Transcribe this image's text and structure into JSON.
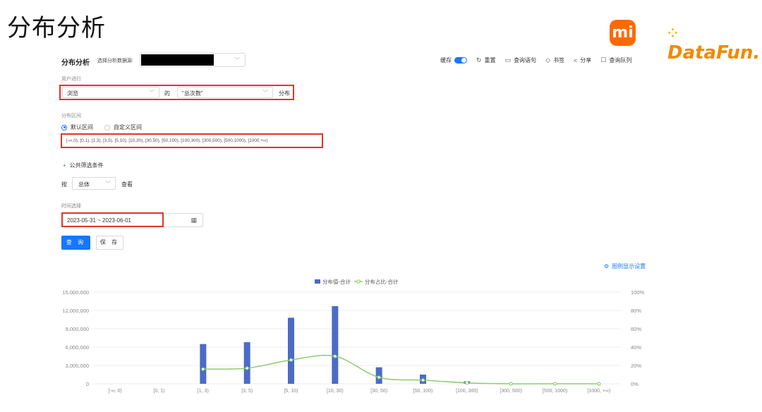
{
  "slide": {
    "title": "分布分析",
    "logo_mi": "mi",
    "logo_datafun": "DataFun."
  },
  "header": {
    "title": "分布分析",
    "datasource_label": "选择分析数据源:"
  },
  "toolbar": {
    "cache_label": "缓存",
    "reset_label": "重置",
    "query_sql_label": "查询语句",
    "bookmark_label": "书签",
    "share_label": "分享",
    "queue_label": "查询队列"
  },
  "behavior": {
    "section_label": "用户进行",
    "event_value": "浏览",
    "of_label": "的",
    "metric_value": "\"总次数\"",
    "dist_label": "分布"
  },
  "interval": {
    "section_label": "分布区间",
    "default_label": "默认区间",
    "custom_label": "自定义区间",
    "ranges_text": "[-∞,0), [0,1), [1,3), [3,5), [5,10), [10,30), [30,50), [50,100), [100,300), [300,500), [500,1000), [1000,+∞)"
  },
  "filter": {
    "add_label": "公共筛选条件"
  },
  "groupby": {
    "by_label": "按",
    "value": "总体",
    "view_label": "查看"
  },
  "time": {
    "section_label": "时间选择",
    "range_value": "2023-05-31 ~ 2023-06-01"
  },
  "buttons": {
    "query_label": "查 询",
    "save_label": "保 存"
  },
  "legend_settings_label": "图例显示设置",
  "colors": {
    "bar": "#4b6bc6",
    "line": "#8fcc6e",
    "accent": "#1677ff",
    "highlight": "#e0342b"
  },
  "chart_data": {
    "type": "bar",
    "categories": [
      "[-∞, 0)",
      "[0, 1)",
      "[1, 3)",
      "[3, 5)",
      "[5, 10)",
      "[10, 30)",
      "[30, 50)",
      "[50, 100)",
      "[100, 300)",
      "[300, 500)",
      "[500, 1000)",
      "[1000, +∞)"
    ],
    "y_ticks": [
      "0",
      "3,000,000",
      "6,000,000",
      "9,000,000",
      "12,000,000",
      "15,000,000"
    ],
    "y2_ticks": [
      "0%",
      "20%",
      "40%",
      "60%",
      "80%",
      "100%"
    ],
    "ylim": [
      0,
      15000000
    ],
    "y2lim": [
      0,
      100
    ],
    "legend_position": "top-center",
    "grid": true,
    "series": [
      {
        "name": "分布值-合计",
        "type": "bar",
        "axis": "left",
        "values": [
          0,
          0,
          6500000,
          6800000,
          10800000,
          12700000,
          2700000,
          1500000,
          400000,
          0,
          0,
          0
        ]
      },
      {
        "name": "分布占比-合计",
        "type": "line",
        "axis": "right",
        "values": [
          null,
          null,
          16,
          17,
          26,
          30,
          7,
          4,
          1,
          0,
          0,
          0
        ]
      }
    ]
  }
}
